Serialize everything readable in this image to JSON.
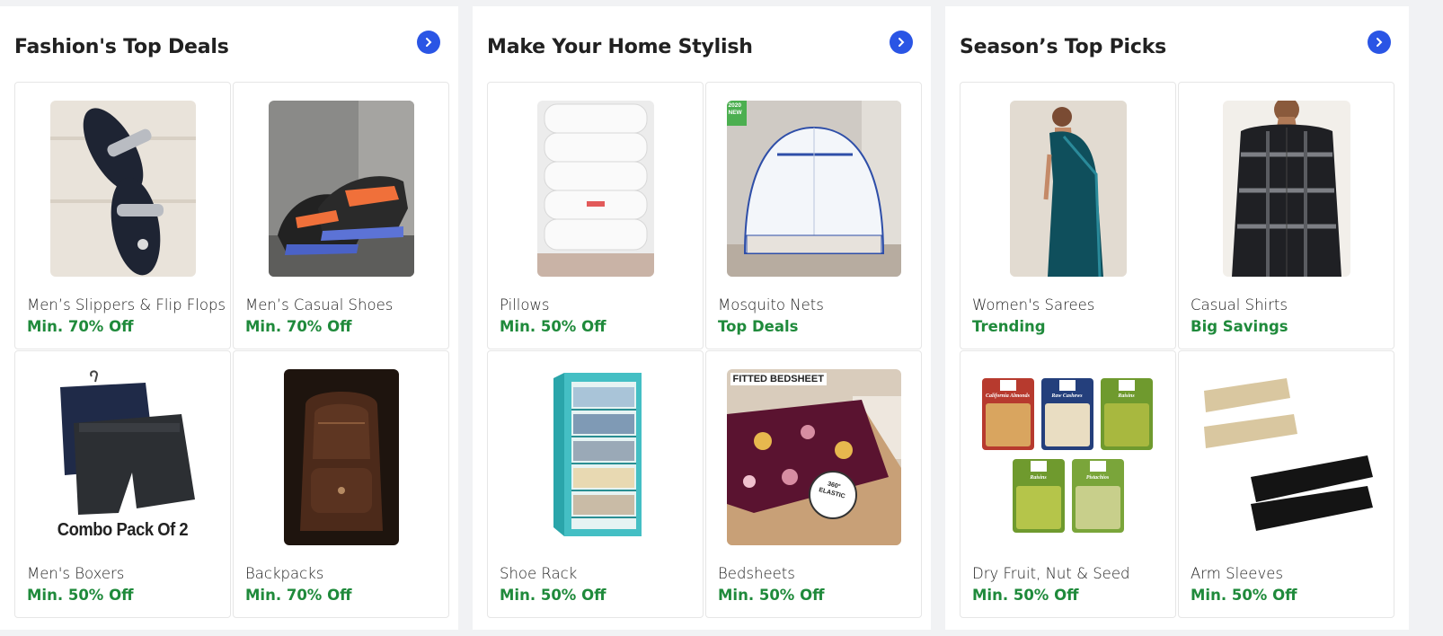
{
  "panels": [
    {
      "title": "Fashion's Top Deals",
      "cards": [
        {
          "name": "Men’s Slippers & Flip Flops",
          "offer": "Min. 70% Off"
        },
        {
          "name": "Men’s Casual Shoes",
          "offer": "Min. 70% Off"
        },
        {
          "name": "Men's Boxers",
          "offer": "Min. 50% Off",
          "image_caption": "Combo Pack Of 2"
        },
        {
          "name": "Backpacks",
          "offer": "Min. 70% Off"
        }
      ]
    },
    {
      "title": "Make Your Home Stylish",
      "cards": [
        {
          "name": "Pillows",
          "offer": "Min. 50% Off"
        },
        {
          "name": "Mosquito Nets",
          "offer": "Top Deals",
          "image_badge": "2020 NEW"
        },
        {
          "name": "Shoe Rack",
          "offer": "Min. 50% Off"
        },
        {
          "name": "Bedsheets",
          "offer": "Min. 50% Off",
          "image_caption": "FITTED BEDSHEET",
          "image_sticker": "360° ELASTIC"
        }
      ]
    },
    {
      "title": "Season’s Top Picks",
      "cards": [
        {
          "name": "Women's Sarees",
          "offer": "Trending"
        },
        {
          "name": "Casual Shirts",
          "offer": "Big Savings"
        },
        {
          "name": "Dry Fruit, Nut & Seed",
          "offer": "Min. 50% Off",
          "pack_labels": [
            "California Almonds",
            "Raw Cashews",
            "Raisins",
            "Raisins",
            "Pistachios"
          ]
        },
        {
          "name": "Arm Sleeves",
          "offer": "Min. 50% Off"
        }
      ]
    }
  ],
  "icons": {
    "panel_arrow": "chevron-right-icon"
  },
  "colors": {
    "accent": "#2a55e5",
    "offer_green": "#1f8a3b",
    "text": "#212121",
    "page_bg": "#f1f2f4"
  }
}
